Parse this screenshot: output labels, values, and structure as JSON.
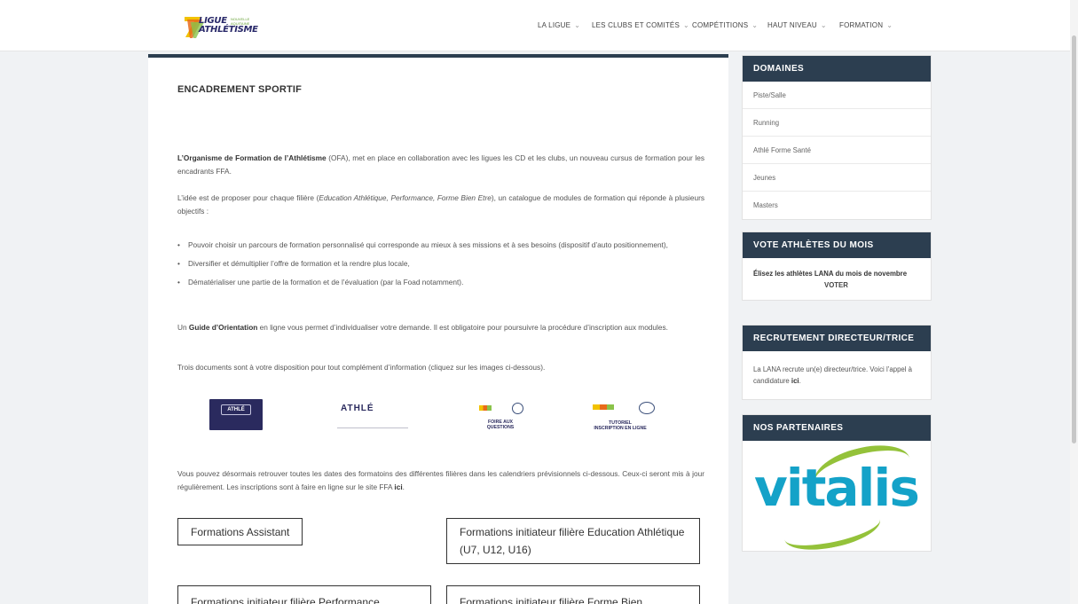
{
  "header": {
    "logo_text_line1": "LIGUE",
    "logo_text_line2": "ATHLÉTISME",
    "logo_small": "NOUVELLE AQUITAINE",
    "nav": [
      {
        "label": "LA LIGUE"
      },
      {
        "label": "LES CLUBS ET COMITÉS"
      },
      {
        "label": "COMPÉTITIONS"
      },
      {
        "label": "HAUT NIVEAU"
      },
      {
        "label": "FORMATION"
      }
    ]
  },
  "main": {
    "title": "ENCADREMENT SPORTIF",
    "p1_bold": "L’Organisme de Formation de l’Athlétisme",
    "p1_rest": " (OFA), met en place en collaboration avec les ligues les CD et les clubs, un nouveau cursus de formation pour les encadrants FFA.",
    "p2_start": "L’idée est de proposer pour chaque filière (",
    "p2_italic": "Education Athlétique, Performance, Forme Bien Etre",
    "p2_end": "), un catalogue de modules de formation qui réponde à plusieurs objectifs :",
    "bullets": [
      "Pouvoir choisir un parcours de formation personnalisé qui corresponde au mieux à ses missions et à ses besoins (dispositif d’auto positionnement),",
      "Diversifier et démultiplier l’offre de formation et la rendre plus locale,",
      "Dématérialiser une partie de la formation et de l’évaluation (par la Foad notamment)."
    ],
    "p3_start": "Un ",
    "p3_bold": "Guide d’Orientation",
    "p3_rest": " en ligne vous permet d’individualiser votre demande. Il est obligatoire pour poursuivre la procédure d’inscription aux modules.",
    "p4": "Trois documents sont à votre disposition pour tout complément d’information (cliquez sur les images ci-dessous).",
    "thumbs": {
      "t1_logo": "ATHLÉ",
      "t2_logo": "ATHLÉ",
      "t3_caption": "FOIRE AUX QUESTIONS",
      "t4_caption1": "TUTORIEL",
      "t4_caption2": "INSCRIPTION EN LIGNE"
    },
    "p5_start": "Vous pouvez désormais retrouver toutes les dates des formatoins des différentes filières dans les calendriers prévisionnels ci-dessous. Ceux-ci seront mis à jour régulièrement. Les inscriptions sont à faire en ligne sur le site FFA ",
    "p5_link": "ici",
    "p5_end": ".",
    "buttons": [
      "Formations Assistant",
      "Formations initiateur filière Education Athlétique (U7, U12, U16)",
      "Formations initiateur filière Performance",
      "Formations initiateur filière Forme Bien"
    ]
  },
  "sidebar": {
    "domaines": {
      "title": "DOMAINES",
      "items": [
        "Piste/Salle",
        "Running",
        "Athlé Forme Santé",
        "Jeunes",
        "Masters"
      ]
    },
    "vote": {
      "title": "VOTE ATHLÈTES DU MOIS",
      "text": "Élisez les athlètes LANA du mois de novembre",
      "link": "VOTER"
    },
    "recrutement": {
      "title": "RECRUTEMENT DIRECTEUR/TRICE",
      "text": "La LANA recrute un(e) directeur/trice. Voici l’appel à candidature ",
      "link": "ici",
      "end": "."
    },
    "partenaires": {
      "title": "NOS PARTENAIRES",
      "logo_text": "vitalis"
    }
  },
  "colors": {
    "widget_header": "#2c3e50",
    "vitalis_blue": "#14a2c8",
    "vitalis_green": "#94c23a"
  }
}
